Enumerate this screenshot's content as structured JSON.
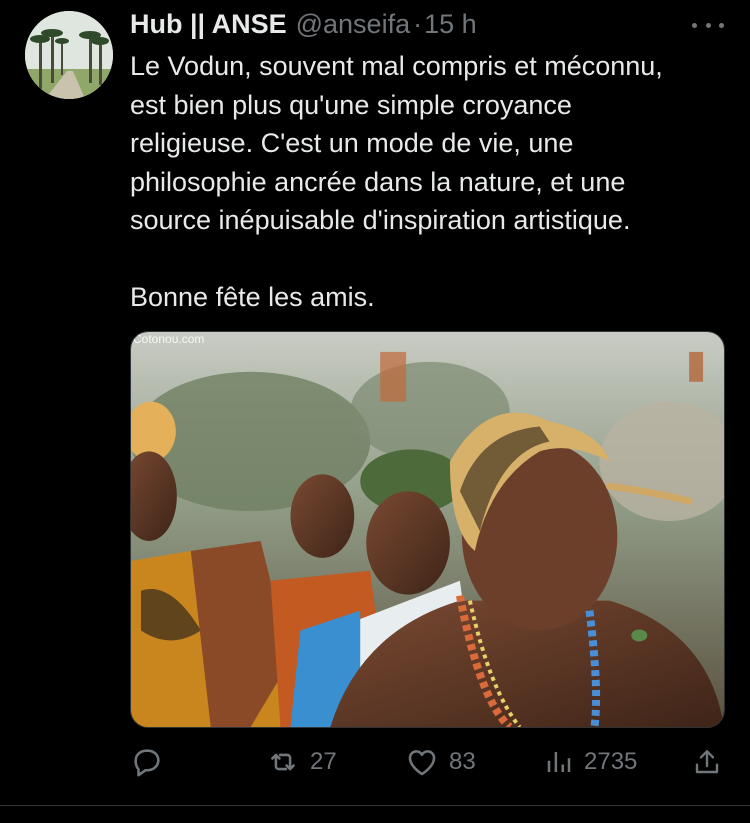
{
  "tweet": {
    "display_name": "Hub || ANSE",
    "handle": "@anseifa",
    "separator": "·",
    "time": "15 h",
    "text_lines": [
      "Le Vodun, souvent mal compris et méconnu,",
      "est bien plus qu'une simple croyance",
      "religieuse. C'est un mode de vie, une",
      "philosophie ancrée dans la nature, et une",
      "source inépuisable d'inspiration artistique."
    ],
    "closing_line": "Bonne fête les amis.",
    "media": {
      "watermark": "Cotonou.com"
    }
  },
  "actions": {
    "replies": "",
    "retweets": "27",
    "likes": "83",
    "views": "2735"
  },
  "icons": {
    "avatar": "palm-trees-avatar",
    "more": "more-horizontal-icon",
    "reply": "reply-icon",
    "retweet": "retweet-icon",
    "like": "heart-icon",
    "views": "views-chart-icon",
    "share": "share-icon"
  },
  "colors": {
    "background": "#000000",
    "text": "#e7e9ea",
    "secondary": "#71767b",
    "border": "#2f3336"
  }
}
